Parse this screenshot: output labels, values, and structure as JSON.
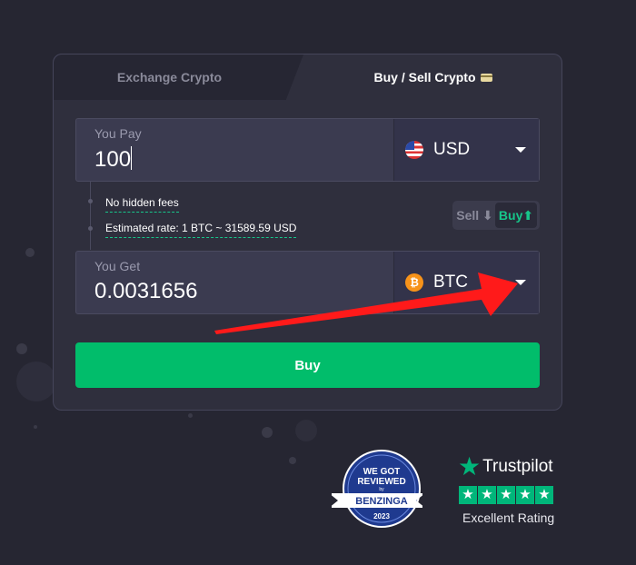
{
  "tabs": {
    "exchange_label": "Exchange Crypto",
    "buysell_label": "Buy / Sell Crypto",
    "buysell_icon": "credit-card-icon"
  },
  "pay": {
    "label": "You Pay",
    "value": "100",
    "currency": "USD",
    "currency_icon": "us-flag-icon"
  },
  "info": {
    "fees": "No hidden fees",
    "rate": "Estimated rate: 1 BTC ~ 31589.59 USD"
  },
  "toggle": {
    "sell_label": "Sell",
    "buy_label": "Buy",
    "active": "buy"
  },
  "get": {
    "label": "You Get",
    "value": "0.0031656",
    "currency": "BTC",
    "currency_icon": "bitcoin-icon"
  },
  "action": {
    "label": "Buy"
  },
  "badge": {
    "line1": "WE GOT",
    "line2": "REVIEWED",
    "by": "by",
    "brand": "BENZINGA",
    "year": "2023"
  },
  "trustpilot": {
    "name": "Trustpilot",
    "rating_text": "Excellent Rating",
    "stars": 5
  },
  "colors": {
    "accent": "#01bd6b",
    "annotation_arrow": "#ff1a1a",
    "background": "#262632"
  }
}
